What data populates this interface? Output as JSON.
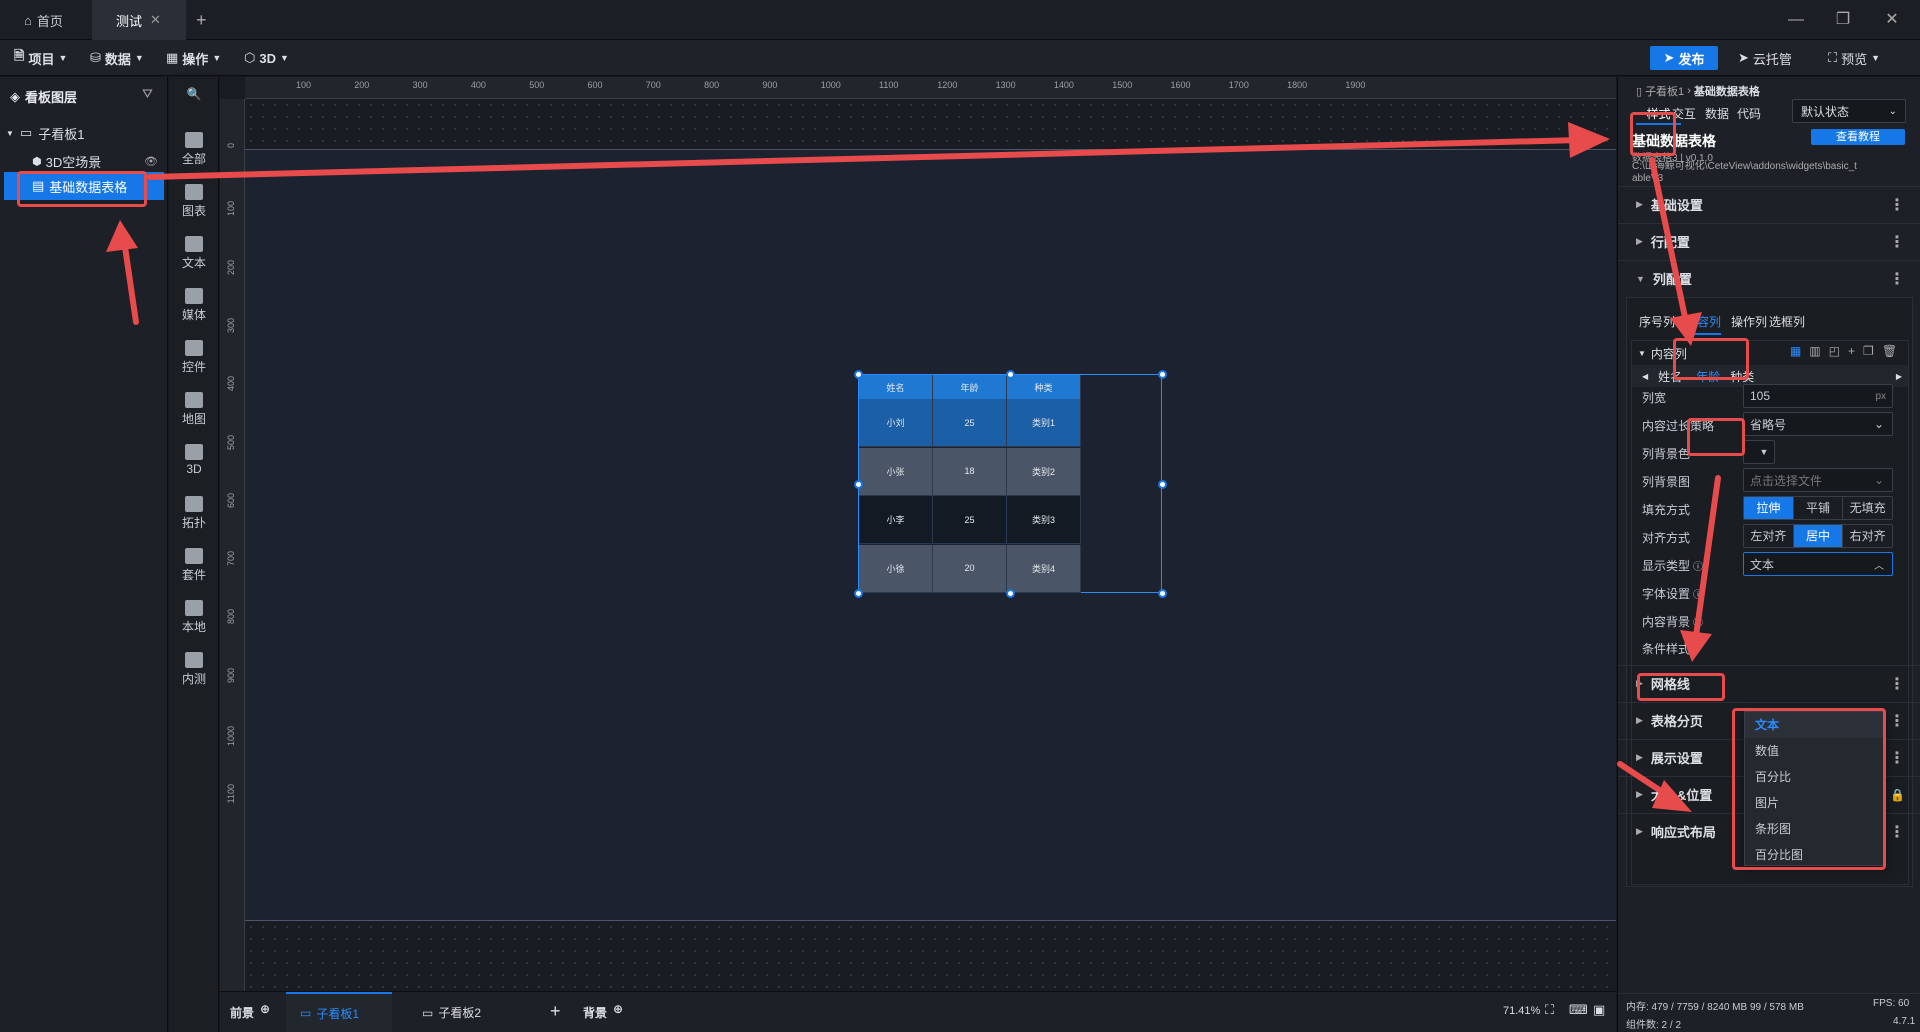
{
  "titlebar": {
    "tabs": [
      {
        "label": "首页",
        "icon": "home-icon"
      },
      {
        "label": "测试",
        "icon": "close-icon"
      }
    ],
    "new_tab": "+",
    "window_controls": [
      "minimize-icon",
      "restore-icon",
      "close-icon"
    ]
  },
  "menubar": {
    "items": [
      {
        "label": "项目",
        "icon": "file-icon"
      },
      {
        "label": "数据",
        "icon": "database-icon"
      },
      {
        "label": "操作",
        "icon": "grid-icon"
      },
      {
        "label": "3D",
        "icon": "cube-icon"
      }
    ],
    "publish": "发布",
    "cloud": "云托管",
    "preview": "预览"
  },
  "layers": {
    "title": "看板图层",
    "tree": [
      {
        "label": "子看板1",
        "level": 0
      },
      {
        "label": "3D空场景",
        "level": 1
      },
      {
        "label": "基础数据表格",
        "level": 1,
        "selected": true
      }
    ]
  },
  "iconbar": {
    "items": [
      "全部",
      "图表",
      "文本",
      "媒体",
      "控件",
      "地图",
      "3D",
      "拓扑",
      "套件",
      "本地",
      "内测"
    ]
  },
  "ruler": {
    "top": [
      "100",
      "200",
      "300",
      "400",
      "500",
      "600",
      "700",
      "800",
      "900",
      "1000",
      "1100",
      "1200",
      "1300",
      "1400",
      "1500",
      "1600",
      "1700",
      "1800",
      "1900"
    ],
    "left": [
      "0",
      "100",
      "200",
      "300",
      "400",
      "500",
      "600",
      "700",
      "800",
      "900",
      "1000",
      "1100"
    ]
  },
  "table": {
    "headers": [
      "姓名",
      "年龄",
      "种类"
    ],
    "rows": [
      [
        "小刘",
        "25",
        "类别1"
      ],
      [
        "小张",
        "18",
        "类别2"
      ],
      [
        "小李",
        "25",
        "类别3"
      ],
      [
        "小徐",
        "20",
        "类别4"
      ]
    ]
  },
  "bottombar": {
    "tabs": [
      "前景",
      "子看板1",
      "子看板2",
      "背景"
    ],
    "add": "+",
    "zoom": "71.41%"
  },
  "rpanel": {
    "breadcrumb": [
      "子看板1",
      "基础数据表格"
    ],
    "tabs": [
      "样式",
      "交互",
      "数据",
      "代码"
    ],
    "state": "默认状态",
    "widget_title": "基础数据表格",
    "widget_meta": "数据表格3 | v0.1.0",
    "widget_path": "C:\\山海鲸可视化\\CeteView\\addons\\widgets\\basic_tableV3",
    "tutorial": "查看教程",
    "sections_top": [
      "基础设置",
      "行配置",
      "列配置"
    ],
    "col_tabs": [
      "序号列",
      "内容列",
      "操作列",
      "选框列"
    ],
    "content_col_title": "内容列",
    "col_names": [
      "姓名",
      "年龄",
      "种类"
    ],
    "fields": {
      "width_label": "列宽",
      "width_value": "105",
      "width_unit": "px",
      "overflow_label": "内容过长策略",
      "overflow_value": "省略号",
      "bg_color_label": "列背景色",
      "bg_image_label": "列背景图",
      "bg_image_placeholder": "点击选择文件",
      "fill_label": "填充方式",
      "fill_options": [
        "拉伸",
        "平铺",
        "无填充"
      ],
      "align_label": "对齐方式",
      "align_options": [
        "左对齐",
        "居中",
        "右对齐"
      ],
      "display_label": "显示类型",
      "display_value": "文本",
      "font_label": "字体设置",
      "content_bg_label": "内容背景",
      "cond_label": "条件样式"
    },
    "dropdown": [
      "文本",
      "数值",
      "百分比",
      "图片",
      "条形图",
      "百分比图"
    ],
    "sections_bottom": [
      "网格线",
      "表格分页",
      "展示设置",
      "大小&位置",
      "响应式布局"
    ],
    "status": {
      "memory": "内存:  479 / 7759 / 8240 MB  99 / 578 MB",
      "fps": "FPS:  60",
      "components": "组件数: 2 / 2",
      "version": "4.7.1"
    }
  }
}
